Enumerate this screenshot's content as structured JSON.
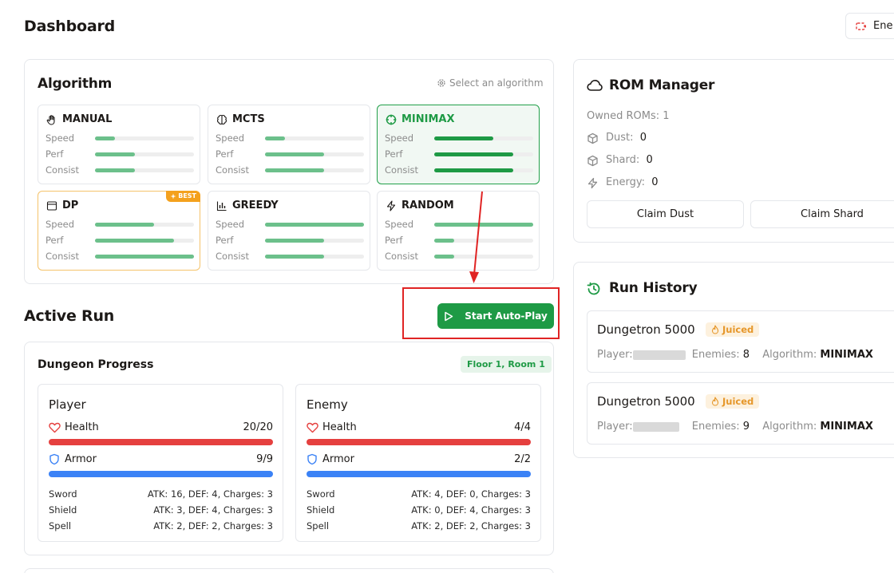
{
  "page_title": "Dashboard",
  "energy_button_label": "Ene",
  "algorithm": {
    "title": "Algorithm",
    "hint": "Select an algorithm",
    "stat_labels": [
      "Speed",
      "Perf",
      "Consist"
    ],
    "cards": [
      {
        "name": "MANUAL",
        "icon": "hand-icon",
        "speed": 0.2,
        "perf": 0.4,
        "consist": 0.4,
        "selected": false
      },
      {
        "name": "MCTS",
        "icon": "brain-icon",
        "speed": 0.2,
        "perf": 0.6,
        "consist": 0.6,
        "selected": false
      },
      {
        "name": "MINIMAX",
        "icon": "crosshair-icon",
        "speed": 0.6,
        "perf": 0.8,
        "consist": 0.8,
        "selected": true
      },
      {
        "name": "DP",
        "icon": "table-icon",
        "speed": 0.6,
        "perf": 0.8,
        "consist": 1.0,
        "selected": false,
        "badge": "BEST"
      },
      {
        "name": "GREEDY",
        "icon": "bar-chart-icon",
        "speed": 1.0,
        "perf": 0.6,
        "consist": 0.6,
        "selected": false
      },
      {
        "name": "RANDOM",
        "icon": "lightning-icon",
        "speed": 1.0,
        "perf": 0.2,
        "consist": 0.2,
        "selected": false
      }
    ]
  },
  "active_run": {
    "title": "Active Run",
    "start_button": "Start Auto-Play",
    "progress_title": "Dungeon Progress",
    "floor_badge": "Floor 1, Room 1",
    "player": {
      "title": "Player",
      "health_label": "Health",
      "health_value": "20/20",
      "health_fraction": 1.0,
      "armor_label": "Armor",
      "armor_value": "9/9",
      "armor_fraction": 1.0,
      "items": [
        {
          "name": "Sword",
          "stats": "ATK: 16, DEF: 4, Charges: 3"
        },
        {
          "name": "Shield",
          "stats": "ATK: 3, DEF: 4, Charges: 3"
        },
        {
          "name": "Spell",
          "stats": "ATK: 2, DEF: 2, Charges: 3"
        }
      ]
    },
    "enemy": {
      "title": "Enemy",
      "health_label": "Health",
      "health_value": "4/4",
      "health_fraction": 1.0,
      "armor_label": "Armor",
      "armor_value": "2/2",
      "armor_fraction": 1.0,
      "items": [
        {
          "name": "Sword",
          "stats": "ATK: 4, DEF: 0, Charges: 3"
        },
        {
          "name": "Shield",
          "stats": "ATK: 0, DEF: 4, Charges: 3"
        },
        {
          "name": "Spell",
          "stats": "ATK: 2, DEF: 2, Charges: 3"
        }
      ]
    }
  },
  "rom_manager": {
    "title": "ROM Manager",
    "owned": "Owned ROMs: 1",
    "dust_label": "Dust:",
    "dust_value": "0",
    "shard_label": "Shard:",
    "shard_value": "0",
    "energy_label": "Energy:",
    "energy_value": "0",
    "claim_dust": "Claim Dust",
    "claim_shard": "Claim Shard"
  },
  "run_history": {
    "title": "Run History",
    "entries": [
      {
        "game": "Dungetron 5000",
        "tag": "Juiced",
        "player_label": "Player:",
        "enemies_label": "Enemies:",
        "enemies_value": "8",
        "algorithm_label": "Algorithm:",
        "algorithm_value": "MINIMAX"
      },
      {
        "game": "Dungetron 5000",
        "tag": "Juiced",
        "player_label": "Player:",
        "enemies_label": "Enemies:",
        "enemies_value": "9",
        "algorithm_label": "Algorithm:",
        "algorithm_value": "MINIMAX"
      }
    ]
  },
  "colors": {
    "accent_green": "#1e9a45",
    "health_red": "#e5403f",
    "armor_blue": "#3b82f6",
    "annotation_red": "#e02424"
  }
}
